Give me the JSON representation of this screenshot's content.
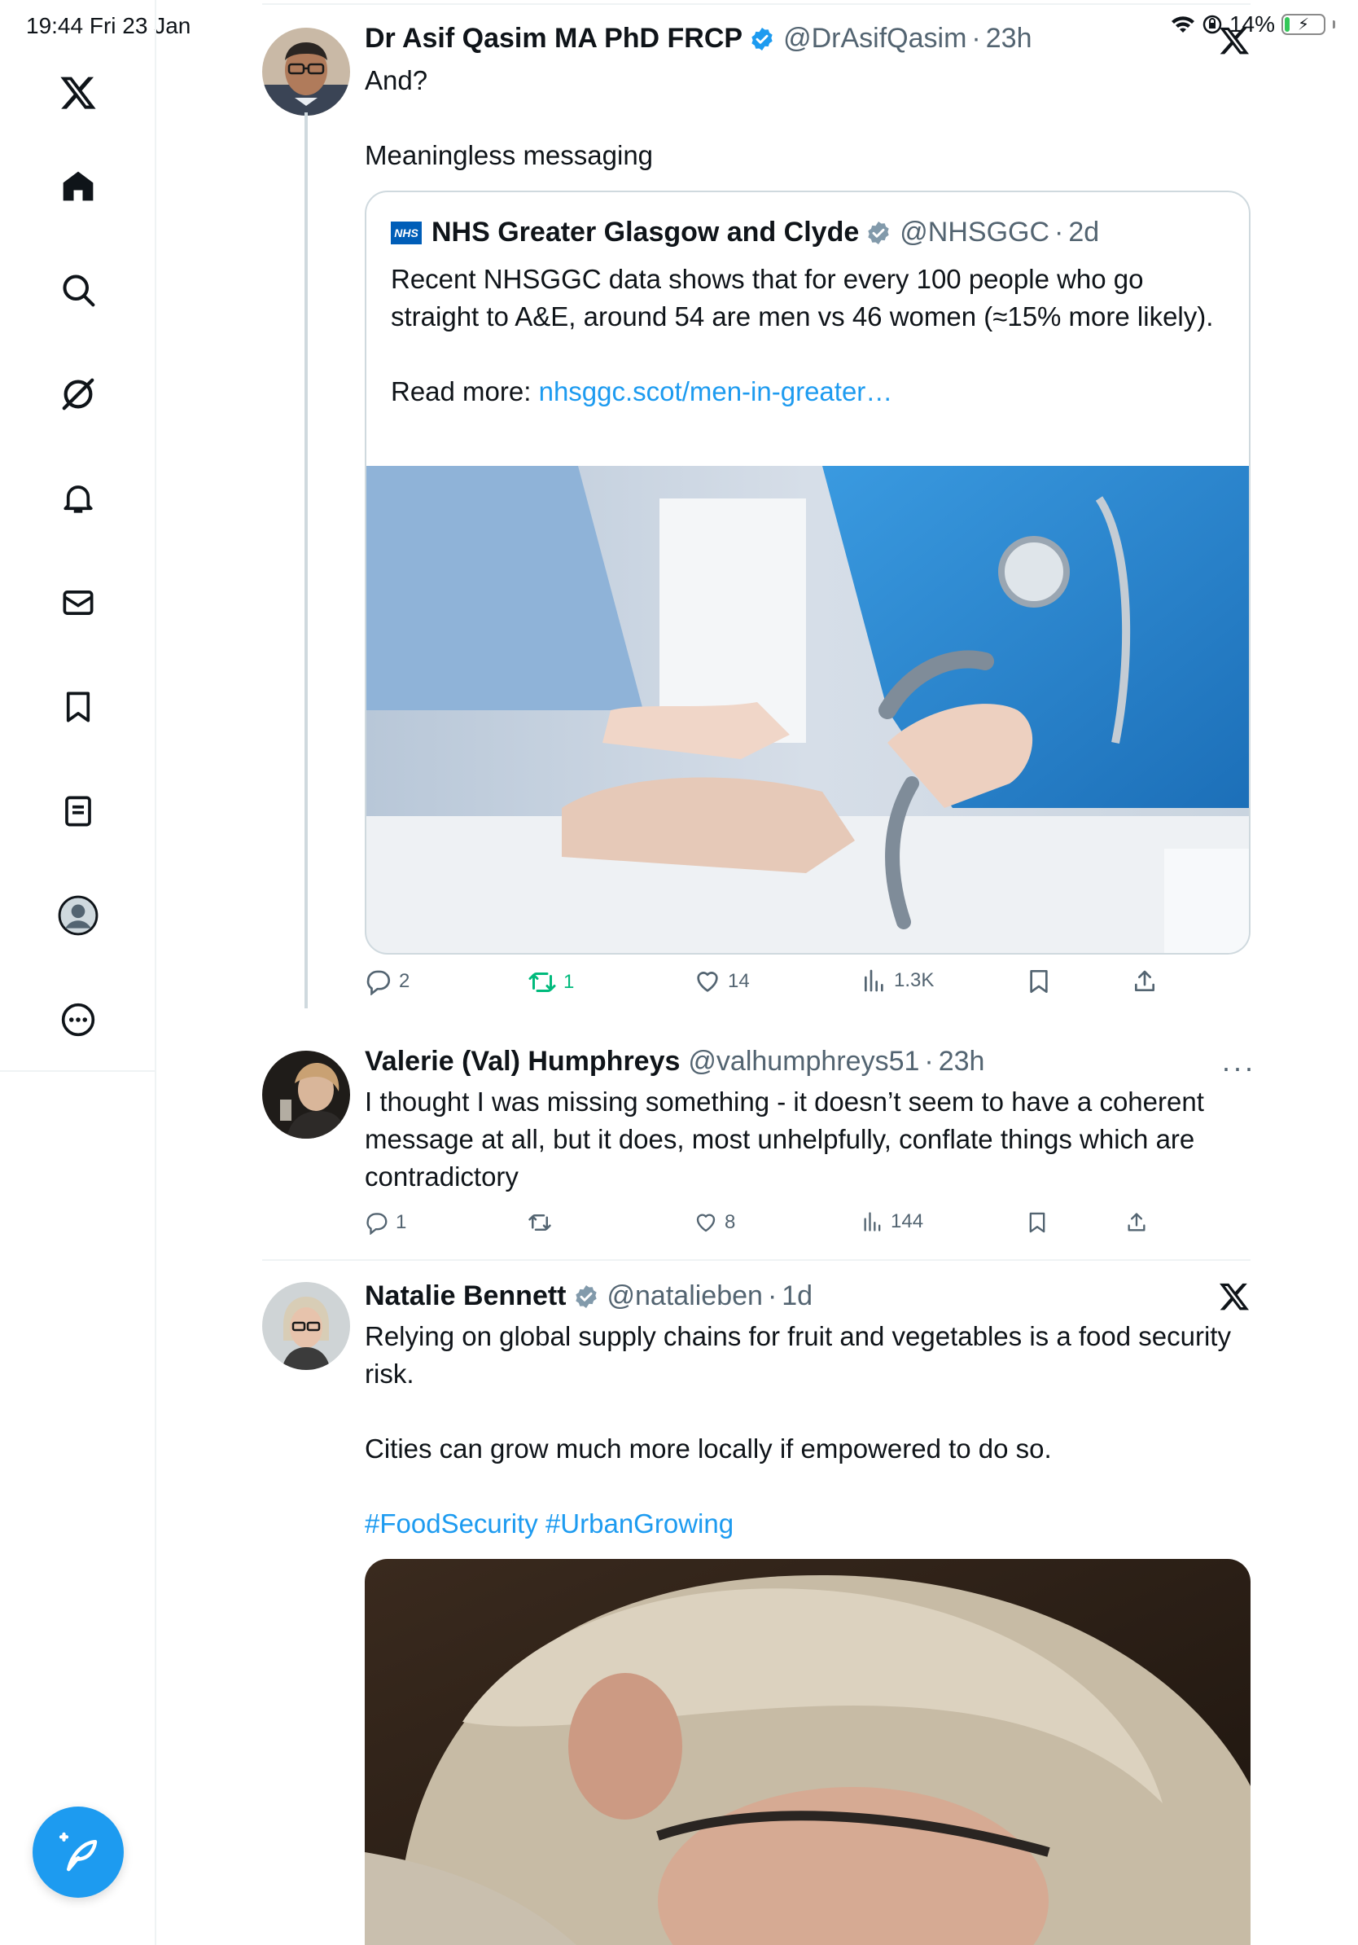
{
  "status_bar": {
    "time": "19:44  Fri 23 Jan",
    "battery": "14%",
    "battery_level": 0.14
  },
  "sidebar": {
    "items": [
      {
        "icon": "x-logo-icon"
      },
      {
        "icon": "home-icon"
      },
      {
        "icon": "search-icon"
      },
      {
        "icon": "grok-icon"
      },
      {
        "icon": "bell-icon"
      },
      {
        "icon": "mail-icon"
      },
      {
        "icon": "bookmark-icon"
      },
      {
        "icon": "lists-icon"
      },
      {
        "icon": "profile-icon"
      },
      {
        "icon": "more-icon"
      }
    ],
    "compose_icon": "compose-post-icon"
  },
  "tweets": [
    {
      "name": "Dr Asif Qasim MA PhD FRCP",
      "handle": "@DrAsifQasim",
      "time": "23h",
      "text": "And?\n\nMeaningless messaging",
      "quote": {
        "name": "NHS Greater Glasgow and Clyde",
        "handle": "@NHSGGC",
        "time": "2d",
        "logo_text": "NHS",
        "text": "Recent NHSGGC data shows that for every 100 people who go straight to A&E, around 54 are men vs 46 women (≈15% more likely).\n\nRead more: ",
        "link": "nhsggc.scot/men-in-greater…"
      },
      "replies": "2",
      "retweets": "1",
      "likes": "14",
      "views": "1.3K"
    },
    {
      "name": "Valerie (Val) Humphreys",
      "handle": "@valhumphreys51",
      "time": "23h",
      "text": "I thought I was missing something - it doesn’t seem to have a coherent message at all, but it does, most unhelpfully, conflate things which are contradictory",
      "replies": "1",
      "retweets": "",
      "likes": "8",
      "views": "144"
    },
    {
      "name": "Natalie Bennett",
      "handle": "@natalieben",
      "time": "1d",
      "text": "Relying on global supply chains for fruit and vegetables is a food security risk.\n\nCities can grow much more locally if empowered to do so.",
      "hashtags": "#FoodSecurity #UrbanGrowing"
    }
  ],
  "colors": {
    "accent": "#1d9bf0",
    "retweet_active": "#00ba7c",
    "verified_blue": "#1d9bf0",
    "verified_grey": "#829aab",
    "text_secondary": "#536471"
  }
}
